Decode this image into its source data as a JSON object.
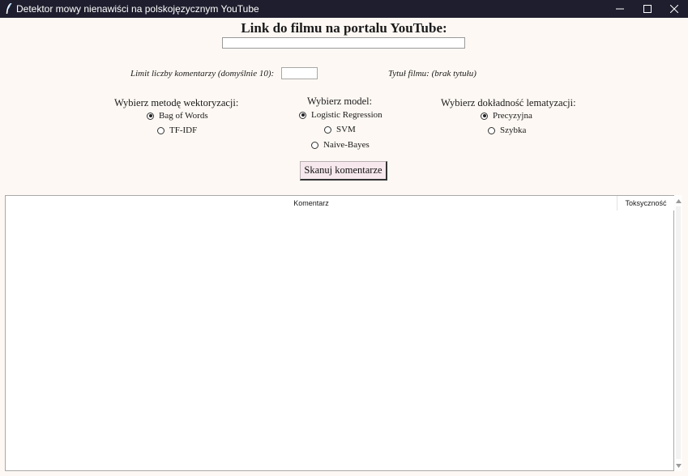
{
  "window": {
    "title": "Detektor mowy nienawiści na polskojęzycznym YouTube",
    "icon": "feather-icon",
    "titlebar_color": "#1e1e2e",
    "background_color": "#fdf8f3"
  },
  "header": {
    "title": "Link do filmu na portalu YouTube:",
    "url_value": ""
  },
  "limit": {
    "label": "Limit liczby komentarzy (domyślnie 10):",
    "value": ""
  },
  "movie": {
    "title_label": "Tytuł filmu: (brak tytułu)"
  },
  "vectorization": {
    "label": "Wybierz metodę wektoryzacji:",
    "options": [
      {
        "label": "Bag of Words",
        "selected": true
      },
      {
        "label": "TF-IDF",
        "selected": false
      }
    ]
  },
  "model": {
    "label": "Wybierz model:",
    "options": [
      {
        "label": "Logistic Regression",
        "selected": true
      },
      {
        "label": "SVM",
        "selected": false
      },
      {
        "label": "Naive-Bayes",
        "selected": false
      }
    ]
  },
  "lemmatization": {
    "label": "Wybierz dokładność lematyzacji:",
    "options": [
      {
        "label": "Precyzyjna",
        "selected": true
      },
      {
        "label": "Szybka",
        "selected": false
      }
    ]
  },
  "scan_button": {
    "label": "Skanuj komentarze",
    "color": "#f6e8ec"
  },
  "results_table": {
    "columns": [
      "Komentarz",
      "Toksyczność"
    ],
    "rows": []
  }
}
